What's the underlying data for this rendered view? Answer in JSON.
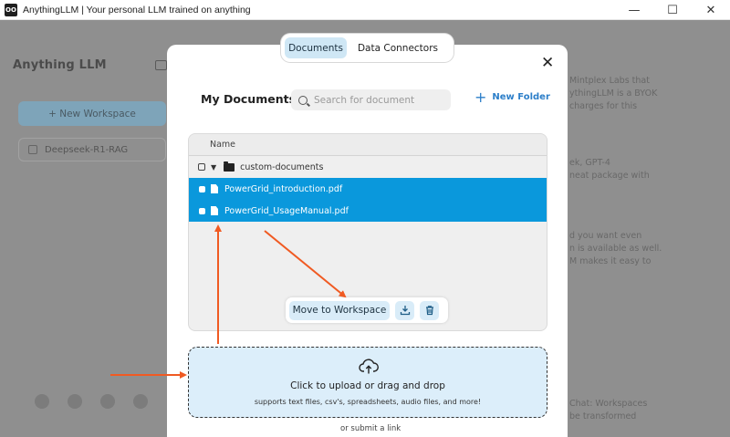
{
  "window": {
    "title": "AnythingLLM | Your personal LLM trained on anything",
    "icon_text": "OO",
    "controls": {
      "minimize": "—",
      "maximize": "☐",
      "close": "✕"
    }
  },
  "sidebar": {
    "logo": "Anything LLM",
    "new_workspace_label": "+ New Workspace",
    "workspaces": [
      {
        "label": "Deepseek-R1-RAG"
      }
    ]
  },
  "background_text": [
    "Mintplex Labs that",
    "ythingLLM is a BYOK",
    "charges for this",
    "ek, GPT-4",
    "neat package with",
    "d you want even",
    "n is available as well.",
    "M makes it easy to",
    "Chat: Workspaces",
    "be transformed"
  ],
  "tabs": [
    {
      "label": "Documents",
      "active": true
    },
    {
      "label": "Data Connectors",
      "active": false
    }
  ],
  "modal": {
    "title": "My Documents",
    "search_placeholder": "Search for document",
    "new_folder_label": "New Folder",
    "close_icon": "✕",
    "table": {
      "column_header": "Name",
      "folder": {
        "name": "custom-documents"
      },
      "files": [
        {
          "name": "PowerGrid_introduction.pdf",
          "selected": true
        },
        {
          "name": "PowerGrid_UsageManual.pdf",
          "selected": true
        }
      ]
    },
    "actions": {
      "move_label": "Move to Workspace",
      "download_icon": "download-icon",
      "delete_icon": "trash-icon"
    },
    "upload": {
      "title": "Click to upload or drag and drop",
      "subtitle": "supports text files, csv's, spreadsheets, audio files, and more!",
      "link_text": "or submit a link"
    }
  },
  "colors": {
    "selection": "#0a98dc",
    "accent": "#2d7fc9",
    "annotation_arrow": "#f05a22",
    "dim_overlay": "#8f8f8f"
  }
}
